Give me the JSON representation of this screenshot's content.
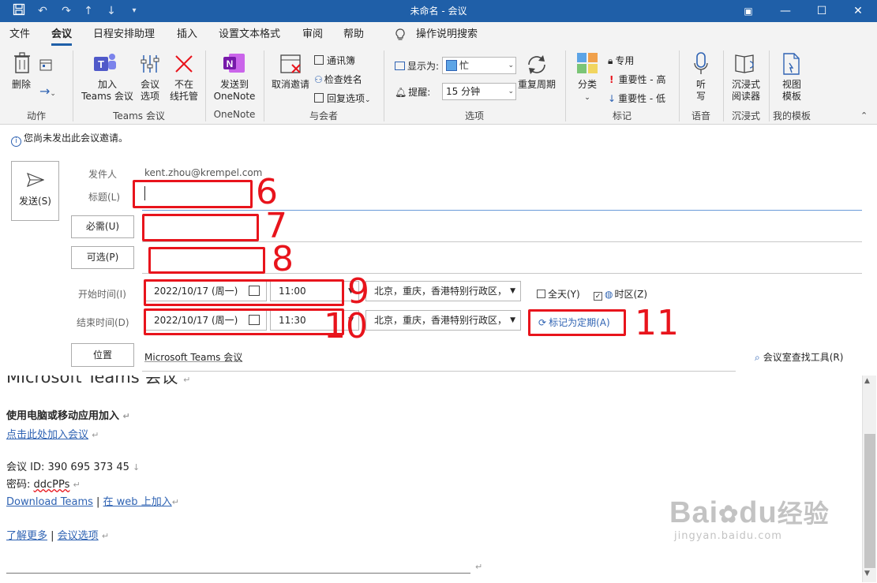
{
  "window": {
    "title": "未命名 - 会议",
    "quick_access_icons": [
      "save-icon",
      "undo-icon",
      "redo-icon",
      "up-arrow-icon",
      "down-arrow-icon",
      "customize-icon"
    ]
  },
  "menu": {
    "tabs": [
      "文件",
      "会议",
      "日程安排助理",
      "插入",
      "设置文本格式",
      "审阅",
      "帮助"
    ],
    "active_tab": "会议",
    "search_label": "操作说明搜索"
  },
  "ribbon": {
    "delete_label": "删除",
    "group_action": "动作",
    "teams_join_label1": "加入",
    "teams_join_label2": "Teams 会议",
    "meeting_options1": "会议",
    "meeting_options2": "选项",
    "not_online1": "不在",
    "not_online2": "线托管",
    "group_teams": "Teams 会议",
    "onenote1": "发送到",
    "onenote2": "OneNote",
    "group_onenote": "OneNote",
    "cancel_invite": "取消邀请",
    "address_book": "通讯簿",
    "check_names": "检查姓名",
    "response_options": "回复选项",
    "group_attendees": "与会者",
    "show_as_label": "显示为:",
    "show_as_value": "忙",
    "reminder_label": "提醒:",
    "reminder_value": "15 分钟",
    "recurrence": "重复周期",
    "group_options": "选项",
    "categorize": "分类",
    "private": "专用",
    "high_importance": "重要性 - 高",
    "low_importance": "重要性 - 低",
    "group_tags": "标记",
    "dictate1": "听",
    "dictate2": "写",
    "group_voice": "语音",
    "immersive1": "沉浸式",
    "immersive2": "阅读器",
    "group_immersive": "沉浸式",
    "view_templates1": "视图",
    "view_templates2": "模板",
    "group_templates": "我的模板"
  },
  "infobar": {
    "message": "您尚未发出此会议邀请。"
  },
  "form": {
    "send_label": "发送(S)",
    "from_label": "发件人",
    "from_value": "kent.zhou@krempel.com",
    "subject_label": "标题(L)",
    "required_label": "必需(U)",
    "optional_label": "可选(P)",
    "start_label": "开始时间(I)",
    "end_label": "结束时间(D)",
    "start_date": "2022/10/17 (周一)",
    "start_time": "11:00",
    "end_date": "2022/10/17 (周一)",
    "end_time": "11:30",
    "timezone": "北京，重庆，香港特别行政区，",
    "allday_label": "全天(Y)",
    "allday_checked": false,
    "timezone_label": "时区(Z)",
    "timezone_checked": true,
    "recurring_link": "标记为定期(A)",
    "location_label": "位置",
    "location_value": "Microsoft Teams 会议",
    "room_finder": "会议室查找工具(R)"
  },
  "annotations": [
    "6",
    "7",
    "8",
    "9",
    "10",
    "11"
  ],
  "body": {
    "heading": "Microsoft Teams 会议",
    "join_heading": "使用电脑或移动应用加入",
    "join_link": "点击此处加入会议",
    "meeting_id": "会议 ID: 390 695 373 45",
    "passcode_label": "密码: ",
    "passcode": "ddcPPs",
    "download_link": "Download Teams",
    "web_link": "在 web 上加入",
    "learn_more": "了解更多",
    "meeting_options": "会议选项"
  },
  "watermark": {
    "text1": "Bai",
    "text2": "du",
    "text3": "经验",
    "url": "jingyan.baidu.com"
  },
  "colors": {
    "title_bar": "#1f5fa8",
    "annotation_red": "#e8141c",
    "link_blue": "#2f63b3"
  }
}
